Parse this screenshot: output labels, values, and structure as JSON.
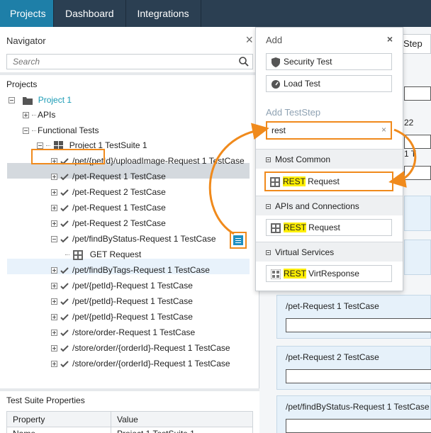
{
  "topbar": {
    "tabs": [
      {
        "label": "Projects"
      },
      {
        "label": "Dashboard"
      },
      {
        "label": "Integrations"
      }
    ]
  },
  "navigator": {
    "title": "Navigator",
    "close": "×",
    "search_placeholder": "Search",
    "projects_label": "Projects",
    "tree": {
      "project": "Project 1",
      "apis": "APIs",
      "functional_tests": "Functional Tests",
      "suite": "Project 1 TestSuite 1",
      "cases": [
        "/pet/{petId}/uploadImage-Request 1 TestCase",
        "/pet-Request 1 TestCase",
        "/pet-Request 2 TestCase",
        "/pet-Request 1 TestCase",
        "/pet-Request 2 TestCase",
        "/pet/findByStatus-Request 1 TestCase"
      ],
      "get_request": "GET Request",
      "cases_after": [
        "/pet/findByTags-Request 1 TestCase",
        "/pet/{petId}-Request 1 TestCase",
        "/pet/{petId}-Request 1 TestCase",
        "/pet/{petId}-Request 1 TestCase",
        "/store/order-Request 1 TestCase",
        "/store/order/{orderId}-Request 1 TestCase",
        "/store/order/{orderId}-Request 1 TestCase"
      ]
    }
  },
  "properties": {
    "title": "Test Suite Properties",
    "col_property": "Property",
    "col_value": "Value",
    "row_name": "Name",
    "row_value": "Project 1 TestSuite 1"
  },
  "editor": {
    "tab_label": "Step",
    "frag_22": "22",
    "frag_1t": "1 T",
    "cards": [
      "/pet-Request 1 TestCase",
      "/pet-Request 2 TestCase",
      "/pet/findByStatus-Request 1 TestCase"
    ]
  },
  "popup": {
    "title": "Add",
    "close": "×",
    "security_test": "Security Test",
    "load_test": "Load Test",
    "add_teststep": "Add TestStep",
    "search_value": "rest",
    "clear": "×",
    "groups": {
      "most_common": "Most Common",
      "apis_connections": "APIs and Connections",
      "virtual_services": "Virtual Services"
    },
    "items": {
      "rest_request_common_hl": "REST",
      "rest_request_common_rest": " Request",
      "rest_request_apis_hl": "REST",
      "rest_request_apis_rest": " Request",
      "rest_virt_hl": "REST",
      "rest_virt_rest": " VirtResponse"
    }
  },
  "colors": {
    "accent_orange": "#f08a1c",
    "topbar": "#2b3f52",
    "active_tab": "#1e7fa8",
    "highlight_yellow": "#ffef00",
    "project_teal": "#1a9bb5"
  }
}
